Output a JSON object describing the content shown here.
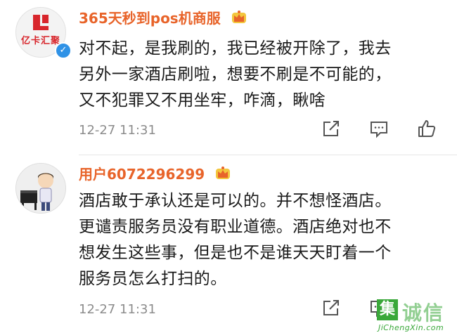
{
  "comments": [
    {
      "username": "365天秒到pos机商服",
      "avatar_text": "亿卡汇聚",
      "verified": true,
      "text_lines": [
        "对不起，是我刷的，我已经被开除了，我去",
        "另外一家酒店刷啦，想要不刷是不可能的，",
        "又不犯罪又不用坐牢，咋滴，瞅啥"
      ],
      "time": "12-27 11:31"
    },
    {
      "username": "用户6072296299",
      "text_lines": [
        "酒店敢于承认还是可以的。并不想怪酒店。",
        "更谴责服务员没有职业道德。酒店绝对也不",
        "想发生这些事，但是也不是谁天天盯着一个",
        "服务员怎么打扫的。"
      ],
      "time": "12-27 11:31"
    }
  ],
  "watermark": {
    "mark": "集",
    "text": "诚信",
    "url": "JiChengXin.com"
  },
  "icons": [
    "crown-vip-icon",
    "verified-badge-icon",
    "share-icon",
    "comment-icon",
    "like-icon"
  ],
  "colors": {
    "username": "#e8642a",
    "text": "#1a1a1a",
    "meta": "#8c8c8c",
    "verified": "#2f92e6",
    "watermark": "#3aa83a"
  }
}
